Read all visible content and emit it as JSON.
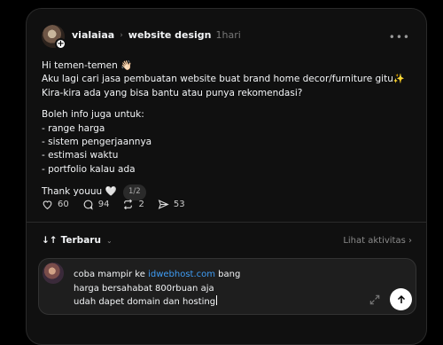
{
  "post": {
    "author": "vialaiaa",
    "topic": "website design",
    "time": "1hari",
    "more_icon": "ellipsis-icon",
    "lines": [
      "Hi temen-temen 👋🏻",
      "Aku lagi cari jasa pembuatan website buat brand home decor/furniture gitu✨",
      "Kira-kira ada yang bisa bantu atau punya rekomendasi?",
      "Boleh info juga untuk:",
      "- range harga",
      "- sistem pengerjaannya",
      "- estimasi waktu",
      "- portfolio kalau ada"
    ],
    "closing": "Thank youuu 🤍",
    "pager": "1/2",
    "stats": {
      "likes": "60",
      "comments": "94",
      "reposts": "2",
      "shares": "53"
    }
  },
  "thread": {
    "sort_label": "Terbaru",
    "activity_link": "Lihat aktivitas"
  },
  "reply": {
    "line1_prefix": "coba mampir ke ",
    "line1_link": "idwebhost.com",
    "line1_suffix": " bang",
    "line2": "harga bersahabat 800rbuan aja",
    "line3": "udah dapet domain dan hosting"
  },
  "colors": {
    "background": "#101010",
    "link": "#3f9df5",
    "muted": "#777777"
  }
}
